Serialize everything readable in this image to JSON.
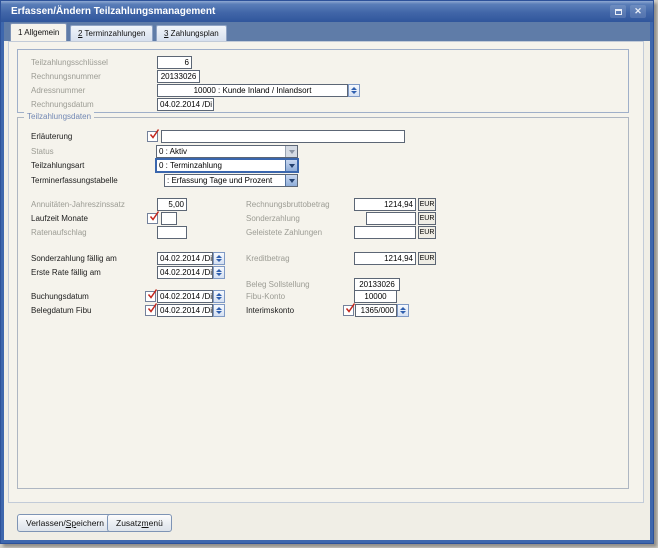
{
  "colors": {
    "titlebar_top": "#8fa9d2",
    "titlebar_bottom": "#30569c",
    "window_border": "#3e67ad",
    "tabstrip": "#5f7ca8",
    "page_bg": "#f5f3ec",
    "group_label": "#7288b4",
    "focus_border": "#3a66ad",
    "check": "#c3271d",
    "disabled_label": "#9c9c94"
  },
  "titlebar": {
    "title": "Erfassen/Ändern Teilzahlungsmanagement",
    "close_glyph": "✕"
  },
  "tabs": [
    {
      "accel": "",
      "label": "1 Allgemein"
    },
    {
      "accel": "2",
      "label": " Terminzahlungen"
    },
    {
      "accel": "3",
      "label": " Zahlungsplan"
    }
  ],
  "top": {
    "teilzahlungsschluessel": {
      "label": "Teilzahlungsschlüssel",
      "value": "6"
    },
    "rechnungsnummer": {
      "label": "Rechnungsnummer",
      "value": "20133026"
    },
    "adressnummer": {
      "label": "Adressnummer",
      "value": "10000 : Kunde Inland / Inlandsort"
    },
    "rechnungsdatum": {
      "label": "Rechnungsdatum",
      "value": "04.02.2014 /Di"
    }
  },
  "group": {
    "title": "Teilzahlungsdaten",
    "erlaeuterung": {
      "label": "Erläuterung",
      "value": ""
    },
    "status": {
      "label": "Status",
      "value": "0 : Aktiv"
    },
    "teilzahlungsart": {
      "label": "Teilzahlungsart",
      "value": "0 : Terminzahlung"
    },
    "terminerfassungstabelle": {
      "label": "Terminerfassungstabelle",
      "value": " : Erfassung Tage und Prozent"
    },
    "annuitaeten_jahreszinssatz": {
      "label": "Annuitäten-Jahreszinssatz",
      "value": "5,00"
    },
    "laufzeit_monate": {
      "label": "Laufzeit Monate",
      "value": ""
    },
    "ratenaufschlag": {
      "label": "Ratenaufschlag",
      "value": ""
    },
    "rechnungsbruttobetrag": {
      "label": "Rechnungsbruttobetrag",
      "value": "1214,94",
      "unit": "EUR"
    },
    "sonderzahlung": {
      "label": "Sonderzahlung",
      "value": "",
      "unit": "EUR"
    },
    "geleistete_zahlungen": {
      "label": "Geleistete Zahlungen",
      "value": "",
      "unit": "EUR"
    },
    "sonderzahlung_faellig_am": {
      "label": "Sonderzahlung fällig am",
      "value": "04.02.2014 /Di"
    },
    "erste_rate_faellig_am": {
      "label": "Erste Rate fällig am",
      "value": "04.02.2014 /Di"
    },
    "kreditbetrag": {
      "label": "Kreditbetrag",
      "value": "1214,94",
      "unit": "EUR"
    },
    "beleg_sollstellung": {
      "label": "Beleg Sollstellung",
      "value": "20133026"
    },
    "buchungsdatum": {
      "label": "Buchungsdatum",
      "value": "04.02.2014 /Di"
    },
    "fibu_konto": {
      "label": "Fibu-Konto",
      "value": "10000"
    },
    "belegdatum_fibu": {
      "label": "Belegdatum Fibu",
      "value": "04.02.2014 /Di"
    },
    "interimskonto": {
      "label": "Interimskonto",
      "value": "1365/000"
    }
  },
  "footer": {
    "verlassen_speichern": {
      "pre": "Verlassen/",
      "accel": "Sp",
      "post": "eichern"
    },
    "zusatzmenu": {
      "pre": "Zusatz",
      "accel": "m",
      "post": "enü"
    }
  }
}
